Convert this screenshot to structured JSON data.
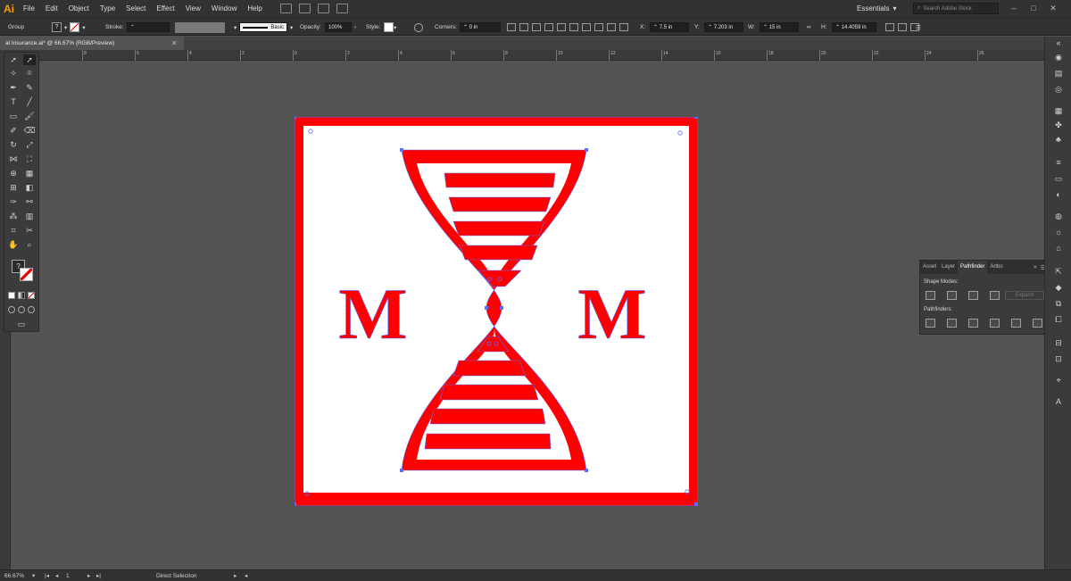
{
  "app": {
    "logo": "Ai"
  },
  "menu": [
    "File",
    "Edit",
    "Object",
    "Type",
    "Select",
    "Effect",
    "View",
    "Window",
    "Help"
  ],
  "workspace": {
    "label": "Essentials",
    "search_placeholder": "Search Adobe Stock"
  },
  "control": {
    "selection_type": "Group",
    "fill_value": "?",
    "stroke_label": "Stroke:",
    "brush_label": "Basic",
    "opacity_label": "Opacity:",
    "opacity_value": "100%",
    "style_label": "Style:",
    "corners_label": "Corners:",
    "corners_value": "0 in",
    "x_label": "X:",
    "x_value": "7.5 in",
    "y_label": "Y:",
    "y_value": "7.203 in",
    "w_label": "W:",
    "w_value": "15 in",
    "h_label": "H:",
    "h_value": "14.4059 in"
  },
  "document": {
    "tab_title": "al Insurance.ai* @ 66.67% (RGB/Preview)"
  },
  "ruler": {
    "h_ticks": [
      "8",
      "6",
      "4",
      "2",
      "0",
      "2",
      "4",
      "6",
      "8",
      "10",
      "12",
      "14",
      "16",
      "18",
      "20",
      "22",
      "24",
      "26"
    ]
  },
  "pathfinder": {
    "tabs": [
      "Asset",
      "Layer",
      "Pathfinder",
      "Artbo"
    ],
    "active_tab": "Pathfinder",
    "shape_modes_label": "Shape Modes:",
    "pathfinders_label": "Pathfinders:",
    "expand_label": "Expand"
  },
  "artwork": {
    "letters": [
      "M",
      "M"
    ],
    "red": "#ff0000",
    "anchor_color": "#5b6cff"
  },
  "status": {
    "zoom": "66.67%",
    "page": "1",
    "tool": "Direct Selection"
  },
  "colors": {
    "accent": "#ff9a00",
    "canvas": "#535353",
    "chrome": "#323232",
    "panel": "#3b3b3b"
  }
}
